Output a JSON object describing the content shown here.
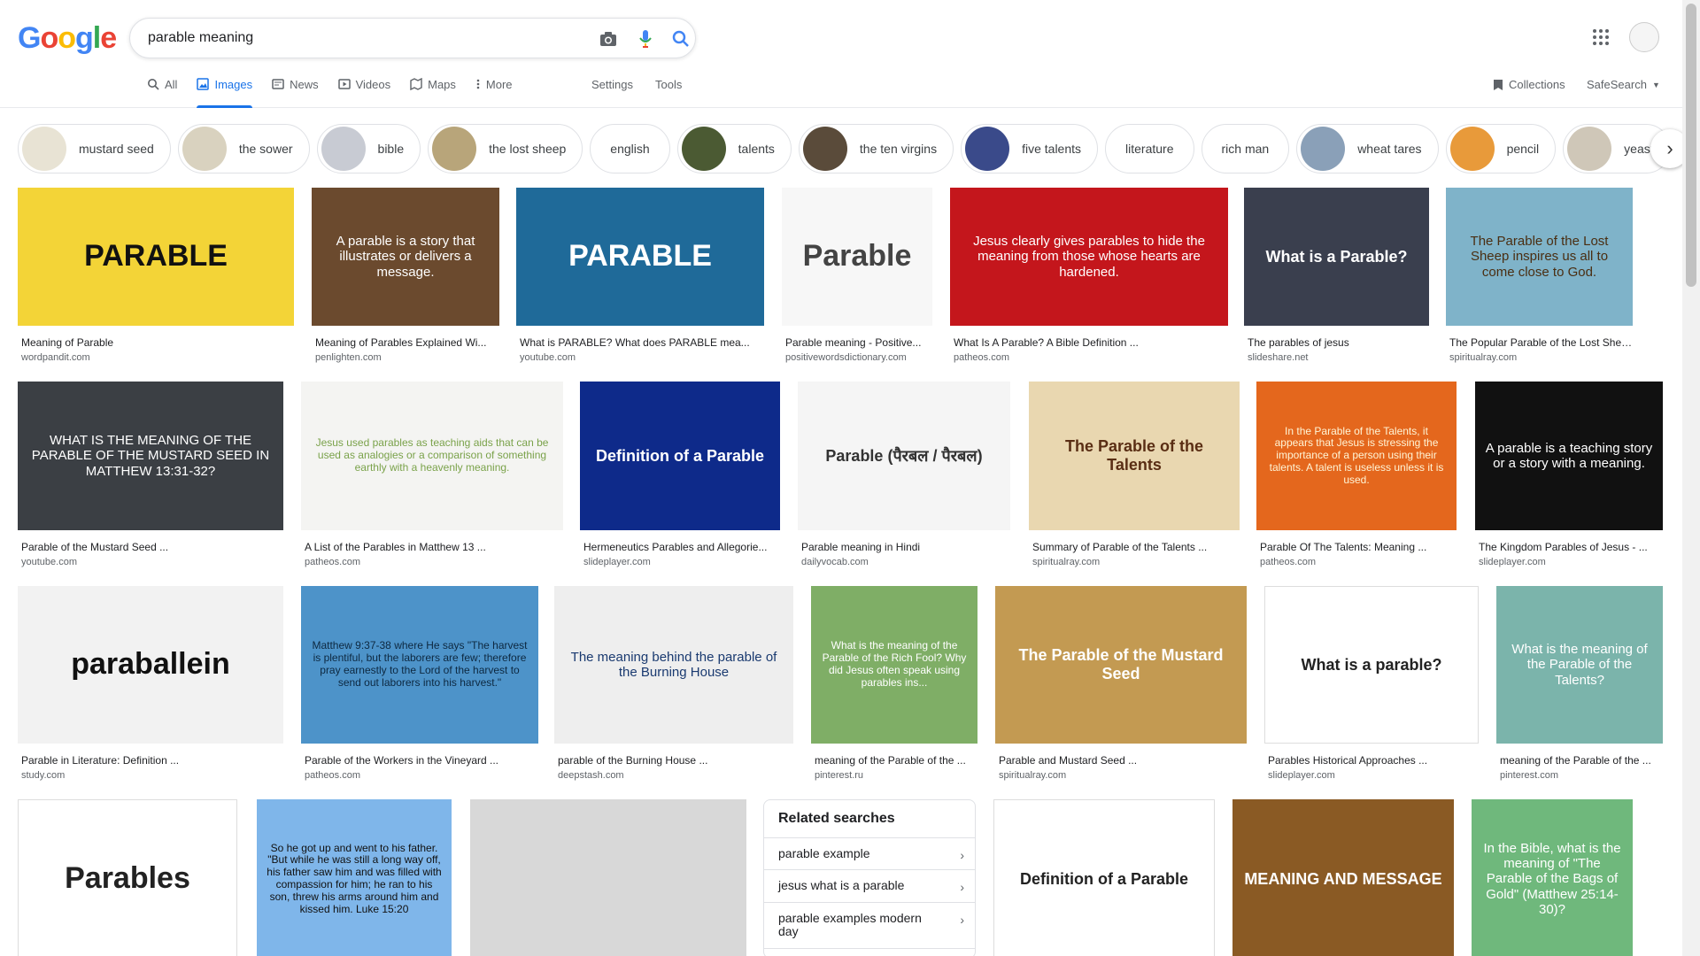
{
  "header": {
    "logo": [
      "G",
      "o",
      "o",
      "g",
      "l",
      "e"
    ],
    "search_value": "parable meaning"
  },
  "tabs": [
    {
      "label": "All",
      "icon": "search-icon"
    },
    {
      "label": "Images",
      "icon": "image-icon",
      "active": true
    },
    {
      "label": "News",
      "icon": "news-icon"
    },
    {
      "label": "Videos",
      "icon": "video-icon"
    },
    {
      "label": "Maps",
      "icon": "map-icon"
    },
    {
      "label": "More",
      "icon": "more-vert-icon"
    }
  ],
  "tools": {
    "settings": "Settings",
    "tools": "Tools",
    "collections": "Collections",
    "safesearch": "SafeSearch"
  },
  "chips": [
    {
      "label": "mustard seed",
      "img": true,
      "color": "#e8e3d4"
    },
    {
      "label": "the sower",
      "img": true,
      "color": "#d9d2bf"
    },
    {
      "label": "bible",
      "img": true,
      "color": "#c8cbd3"
    },
    {
      "label": "the lost sheep",
      "img": true,
      "color": "#b8a57a"
    },
    {
      "label": "english",
      "img": false
    },
    {
      "label": "talents",
      "img": true,
      "color": "#4b5a33"
    },
    {
      "label": "the ten virgins",
      "img": true,
      "color": "#5a4b3a"
    },
    {
      "label": "five talents",
      "img": true,
      "color": "#3a4a8a"
    },
    {
      "label": "literature",
      "img": false
    },
    {
      "label": "rich man",
      "img": false
    },
    {
      "label": "wheat tares",
      "img": true,
      "color": "#8aa0b8"
    },
    {
      "label": "pencil",
      "img": true,
      "color": "#e89a3a"
    },
    {
      "label": "yeast",
      "img": true,
      "color": "#cfc7b8"
    }
  ],
  "images": [
    {
      "caption": "Meaning of Parable",
      "source": "wordpandit.com",
      "bg": "#f3d437",
      "fg": "#111",
      "text": "PARABLE"
    },
    {
      "caption": "Meaning of Parables Explained Wi...",
      "source": "penlighten.com",
      "bg": "#6b4a2e",
      "fg": "#fff",
      "text": "A parable is a story that illustrates or delivers a message."
    },
    {
      "caption": "What is PARABLE? What does PARABLE mea...",
      "source": "youtube.com",
      "bg": "#1f6a99",
      "fg": "#fff",
      "text": "PARABLE"
    },
    {
      "caption": "Parable meaning - Positive...",
      "source": "positivewordsdictionary.com",
      "bg": "#f7f7f7",
      "fg": "#444",
      "text": "Parable"
    },
    {
      "caption": "What Is A Parable? A Bible Definition ...",
      "source": "patheos.com",
      "bg": "#c4161c",
      "fg": "#fff",
      "text": "Jesus clearly gives parables to hide the meaning from those whose hearts are hardened."
    },
    {
      "caption": "The parables of jesus",
      "source": "slideshare.net",
      "bg": "#3a3f4e",
      "fg": "#fff",
      "text": "What is a Parable?"
    },
    {
      "caption": "The Popular Parable of the Lost Sheep ...",
      "source": "spiritualray.com",
      "bg": "#7fb3c9",
      "fg": "#4a2e12",
      "text": "The Parable of the Lost Sheep inspires us all to come close to God."
    },
    {
      "caption": "Parable of the Mustard Seed ...",
      "source": "youtube.com",
      "bg": "#3b3f44",
      "fg": "#fff",
      "text": "WHAT IS THE MEANING OF THE PARABLE OF THE MUSTARD SEED IN MATTHEW 13:31-32?"
    },
    {
      "caption": "A List of the Parables in Matthew 13 ...",
      "source": "patheos.com",
      "bg": "#f4f4f2",
      "fg": "#7aa24a",
      "text": "Jesus used parables as teaching aids that can be used as analogies or a comparison of something earthly with a heavenly meaning."
    },
    {
      "caption": "Hermeneutics Parables and Allegorie...",
      "source": "slideplayer.com",
      "bg": "#0e2a8a",
      "fg": "#fff",
      "text": "Definition of a Parable"
    },
    {
      "caption": "Parable meaning in Hindi",
      "source": "dailyvocab.com",
      "bg": "#f5f5f5",
      "fg": "#333",
      "text": "Parable (पैरबल / पैरबल)"
    },
    {
      "caption": "Summary of Parable of the Talents ...",
      "source": "spiritualray.com",
      "bg": "#e9d7b0",
      "fg": "#5a2e14",
      "text": "The Parable of the Talents"
    },
    {
      "caption": "Parable Of The Talents: Meaning ...",
      "source": "patheos.com",
      "bg": "#e4671d",
      "fg": "#fff5d6",
      "text": "In the Parable of the Talents, it appears that Jesus is stressing the importance of a person using their talents. A talent is useless unless it is used."
    },
    {
      "caption": "The Kingdom Parables of Jesus - ...",
      "source": "slideplayer.com",
      "bg": "#111",
      "fg": "#fff",
      "text": "A parable is a teaching story or a story with a meaning."
    },
    {
      "caption": "Parable in Literature: Definition ...",
      "source": "study.com",
      "bg": "#f2f2f2",
      "fg": "#111",
      "text": "paraballein"
    },
    {
      "caption": "Parable of the Workers in the Vineyard ...",
      "source": "patheos.com",
      "bg": "#4d93c9",
      "fg": "#0d2840",
      "text": "Matthew 9:37-38 where He says \"The harvest is plentiful, but the laborers are few; therefore pray earnestly to the Lord of the harvest to send out laborers into his harvest.\""
    },
    {
      "caption": "parable of the Burning House ...",
      "source": "deepstash.com",
      "bg": "#eeeeee",
      "fg": "#1a3a70",
      "text": "The meaning behind the parable of the Burning House"
    },
    {
      "caption": "meaning of the Parable of the ...",
      "source": "pinterest.ru",
      "bg": "#7fae66",
      "fg": "#fff",
      "text": "What is the meaning of the Parable of the Rich Fool? Why did Jesus often speak using parables ins..."
    },
    {
      "caption": "Parable and Mustard Seed ...",
      "source": "spiritualray.com",
      "bg": "#c39a52",
      "fg": "#fff",
      "text": "The Parable of the Mustard Seed"
    },
    {
      "caption": "Parables Historical Approaches ...",
      "source": "slideplayer.com",
      "bg": "#ffffff",
      "fg": "#222",
      "text": "What is a parable?"
    },
    {
      "caption": "meaning of the Parable of the ...",
      "source": "pinterest.com",
      "bg": "#7bb4ab",
      "fg": "#fff",
      "text": "What is the meaning of the Parable of the Talents?"
    },
    {
      "caption": "",
      "source": "",
      "bg": "#ffffff",
      "fg": "#222",
      "text": "Parables"
    },
    {
      "caption": "",
      "source": "",
      "bg": "#7fb6ea",
      "fg": "#111",
      "text": "So he got up and went to his father. \"But while he was still a long way off, his father saw him and was filled with compassion for him; he ran to his son, threw his arms around him and kissed him. Luke 15:20"
    },
    {
      "caption": "",
      "source": "",
      "bg": "#d8d8d8",
      "fg": "#333",
      "text": ""
    },
    {
      "caption": "",
      "source": "",
      "bg": "#ffffff",
      "fg": "#222",
      "text": "Definition of a Parable"
    },
    {
      "caption": "",
      "source": "",
      "bg": "#8a5a24",
      "fg": "#fff",
      "text": "MEANING AND MESSAGE"
    },
    {
      "caption": "",
      "source": "",
      "bg": "#6fb87c",
      "fg": "#fff",
      "text": "In the Bible, what is the meaning of \"The Parable of the Bags of Gold\" (Matthew 25:14-30)?"
    }
  ],
  "related": {
    "title": "Related searches",
    "items": [
      "parable example",
      "jesus what is a parable",
      "parable examples modern day"
    ]
  }
}
